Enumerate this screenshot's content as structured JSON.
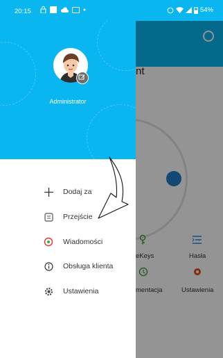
{
  "status_bar": {
    "time": "20:15",
    "battery": "54%"
  },
  "background_app": {
    "title_fragment": "nt",
    "grid": [
      {
        "label": "eKeys",
        "icon": "key-icon"
      },
      {
        "label": "Hasła",
        "icon": "list-icon"
      },
      {
        "label": "mentacja",
        "icon": "clock-icon"
      },
      {
        "label": "Ustawienia",
        "icon": "gear-icon"
      }
    ]
  },
  "drawer": {
    "user_name": "Administrator",
    "menu": [
      {
        "label": "Dodaj za",
        "icon": "plus-icon"
      },
      {
        "label": "Przejście",
        "icon": "receipt-icon"
      },
      {
        "label": "Wiadomości",
        "icon": "message-icon"
      },
      {
        "label": "Obsługa klienta",
        "icon": "info-icon"
      },
      {
        "label": "Ustawienia",
        "icon": "gear-icon"
      }
    ]
  },
  "colors": {
    "accent": "#0ab6ef",
    "message_red": "#e53935",
    "settings_red": "#e64a19",
    "green": "#43a047"
  }
}
